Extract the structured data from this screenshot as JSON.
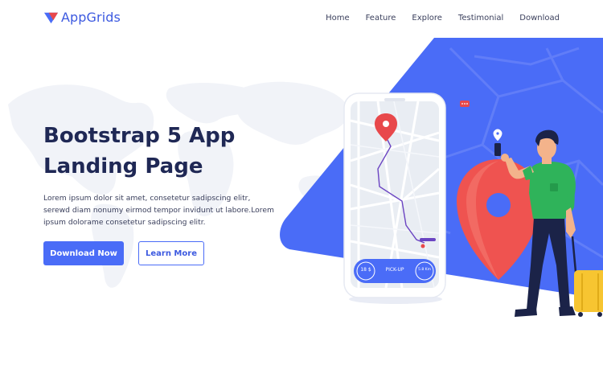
{
  "brand": {
    "name": "AppGrids"
  },
  "nav": {
    "items": [
      {
        "label": "Home"
      },
      {
        "label": "Feature"
      },
      {
        "label": "Explore"
      },
      {
        "label": "Testimonial"
      },
      {
        "label": "Download"
      }
    ]
  },
  "hero": {
    "title_lines": [
      "Bootstrap 5 App",
      "Landing Page"
    ],
    "description_lines": [
      "Lorem ipsum dolor sit amet, consetetur sadipscing elitr,",
      "serewd diam nonumy eirmod tempor invidunt ut labore.Lorem",
      "ipsum dolorame consetetur sadipscing elitr."
    ],
    "primary_button": "Download Now",
    "secondary_button": "Learn More"
  },
  "phone": {
    "left_chip": "18 $",
    "center_label": "PICK-UP",
    "right_chip": "5.8 Km"
  },
  "colors": {
    "accent": "#4a6cf7",
    "heading": "#1f2855",
    "pin_red": "#e8484b",
    "shirt_green": "#2fb35a",
    "luggage_yellow": "#f7c531"
  }
}
